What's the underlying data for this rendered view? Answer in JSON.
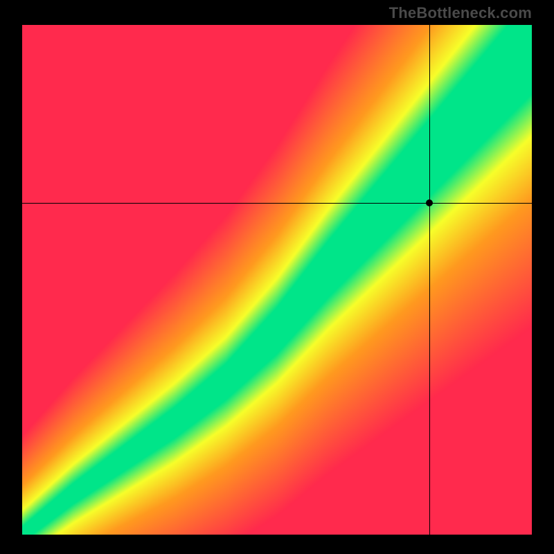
{
  "watermark": "TheBottleneck.com",
  "colors": {
    "red": "#ff2a4d",
    "orange": "#ff9a1f",
    "yellow": "#f7ff2a",
    "green": "#00e589",
    "frame": "#000000"
  },
  "chart_data": {
    "type": "heatmap",
    "title": "",
    "xlabel": "",
    "ylabel": "",
    "xlim": [
      0,
      100
    ],
    "ylim": [
      0,
      100
    ],
    "marker": {
      "x": 80,
      "y": 65
    },
    "crosshair": {
      "x": 80,
      "y": 65
    },
    "ideal_band": {
      "description": "Optimal diagonal band (green), widening toward larger x/y; surrounded by yellow transition, fading to orange then red away from diagonal.",
      "control_points": [
        {
          "x": 0,
          "center_y": 0,
          "half_width": 1.5
        },
        {
          "x": 10,
          "center_y": 8,
          "half_width": 2.0
        },
        {
          "x": 20,
          "center_y": 15,
          "half_width": 2.5
        },
        {
          "x": 30,
          "center_y": 22,
          "half_width": 3.0
        },
        {
          "x": 40,
          "center_y": 30,
          "half_width": 3.5
        },
        {
          "x": 50,
          "center_y": 40,
          "half_width": 4.5
        },
        {
          "x": 60,
          "center_y": 52,
          "half_width": 5.5
        },
        {
          "x": 70,
          "center_y": 63,
          "half_width": 6.5
        },
        {
          "x": 80,
          "center_y": 74,
          "half_width": 7.5
        },
        {
          "x": 90,
          "center_y": 85,
          "half_width": 8.5
        },
        {
          "x": 100,
          "center_y": 96,
          "half_width": 9.5
        }
      ]
    }
  }
}
